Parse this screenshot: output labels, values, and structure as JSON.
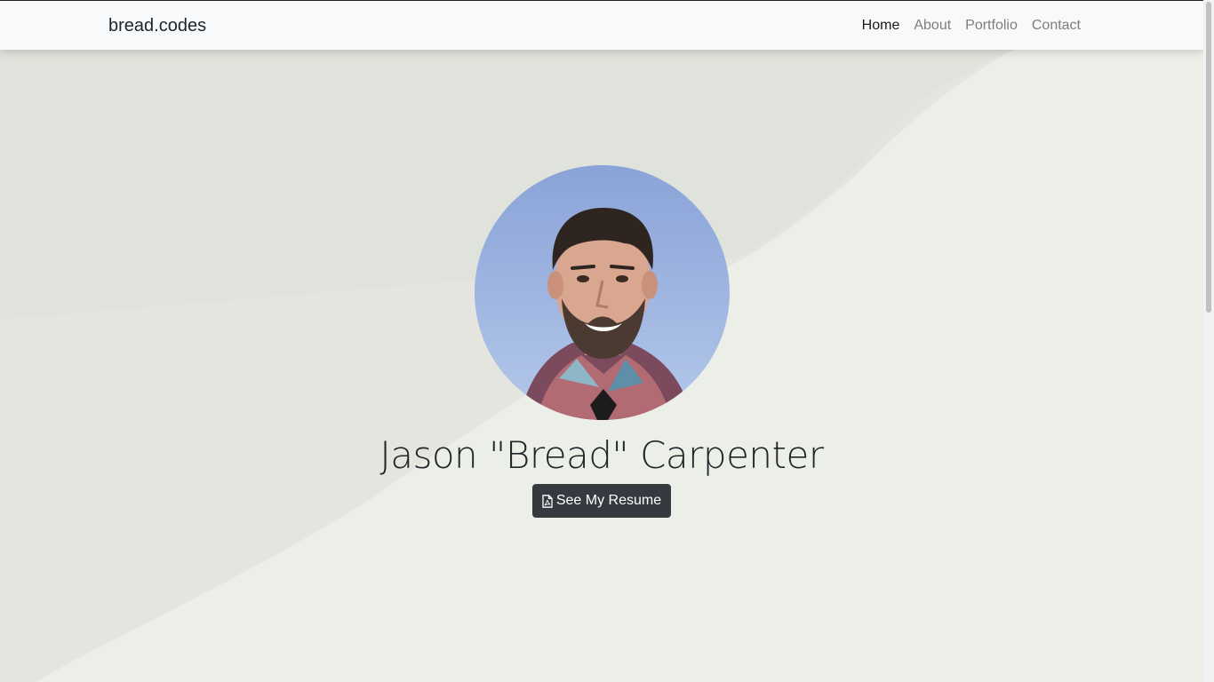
{
  "navbar": {
    "brand": "bread.codes",
    "links": [
      {
        "label": "Home",
        "active": true
      },
      {
        "label": "About",
        "active": false
      },
      {
        "label": "Portfolio",
        "active": false
      },
      {
        "label": "Contact",
        "active": false
      }
    ]
  },
  "hero": {
    "name": "Jason \"Bread\" Carpenter",
    "resume_button": {
      "label": "See My Resume",
      "icon": "file-pdf-icon"
    },
    "avatar_alt": "profile-photo"
  },
  "colors": {
    "navbar_bg": "#f8f9fa",
    "button_bg": "#343a40",
    "background_light": "#eef0ea",
    "background_dark": "#dfe1da",
    "text": "#212529"
  }
}
